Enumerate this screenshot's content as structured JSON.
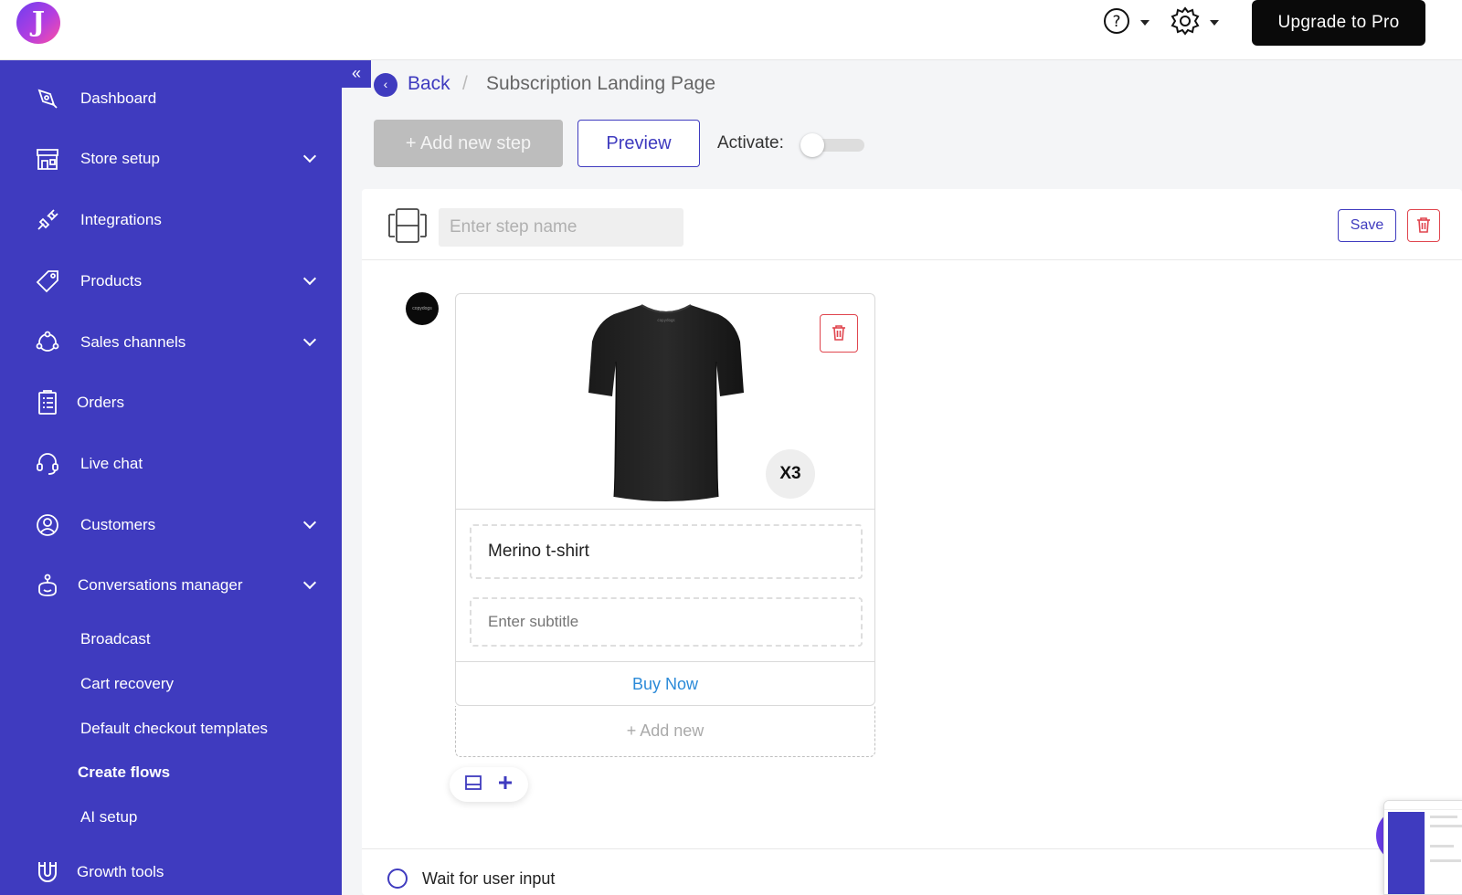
{
  "app": {
    "logo_letter": "J"
  },
  "header": {
    "help_icon": "question-circle-icon",
    "settings_icon": "gear-icon",
    "upgrade_label": "Upgrade to Pro"
  },
  "sidebar": {
    "collapse_icon": "double-chevron-left-icon",
    "items": [
      {
        "label": "Dashboard",
        "icon": "pen-nib-icon",
        "expandable": false
      },
      {
        "label": "Store setup",
        "icon": "storefront-icon",
        "expandable": true
      },
      {
        "label": "Integrations",
        "icon": "plug-icon",
        "expandable": false
      },
      {
        "label": "Products",
        "icon": "tag-icon",
        "expandable": true
      },
      {
        "label": "Sales channels",
        "icon": "network-icon",
        "expandable": true
      },
      {
        "label": "Orders",
        "icon": "clipboard-list-icon",
        "expandable": false
      },
      {
        "label": "Live chat",
        "icon": "headset-icon",
        "expandable": false
      },
      {
        "label": "Customers",
        "icon": "user-circle-icon",
        "expandable": true
      },
      {
        "label": "Conversations manager",
        "icon": "bot-icon",
        "expandable": true
      },
      {
        "label": "Growth tools",
        "icon": "magnet-icon",
        "expandable": false
      }
    ],
    "sub_items": [
      {
        "label": "Broadcast",
        "active": false
      },
      {
        "label": "Cart recovery",
        "active": false
      },
      {
        "label": "Default checkout templates",
        "active": false
      },
      {
        "label": "Create flows",
        "active": true
      },
      {
        "label": "AI setup",
        "active": false
      }
    ]
  },
  "breadcrumb": {
    "back_label": "Back",
    "separator": "/",
    "current": "Subscription Landing Page"
  },
  "toolbar": {
    "add_step_label": "+ Add new step",
    "preview_label": "Preview",
    "activate_label": "Activate:",
    "activate_on": false
  },
  "step": {
    "name_placeholder": "Enter step name",
    "save_label": "Save",
    "avatar_text": "copydogs",
    "product": {
      "title": "Merino t-shirt",
      "subtitle_placeholder": "Enter subtitle",
      "quantity_badge": "X3",
      "button_label": "Buy Now",
      "add_new_label": "+ Add new"
    },
    "wait_label": "Wait for user input"
  },
  "colors": {
    "brand": "#3f3bbf",
    "danger": "#e0454e",
    "link": "#2b8ad8",
    "upgrade_bg": "#0a0a0a"
  }
}
